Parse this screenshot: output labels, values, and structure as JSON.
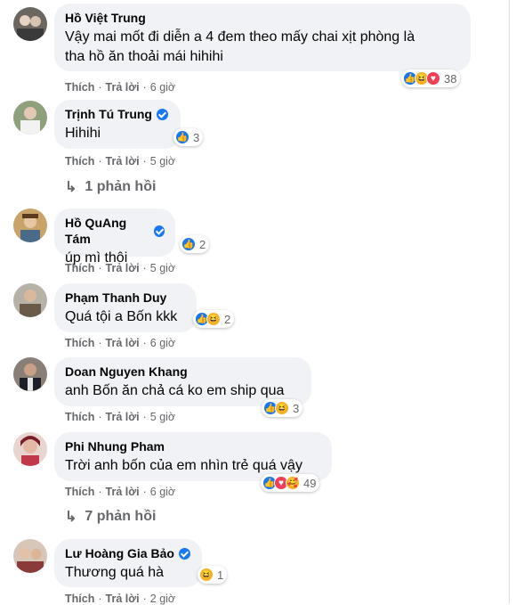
{
  "labels": {
    "like": "Thích",
    "reply": "Trả lời",
    "dot": "·"
  },
  "comments": [
    {
      "name": "Hồ Việt Trung",
      "verified": false,
      "text1": "Vậy mai mốt đi diễn a 4 đem theo mấy chai xịt phòng là",
      "text2": "tha hồ ăn thoải mái hihihi",
      "reactions": [
        "like",
        "haha",
        "love"
      ],
      "count": "38",
      "time": "6 giờ"
    },
    {
      "name": "Trịnh Tú Trung",
      "verified": true,
      "text1": "Hihihi",
      "reactions": [
        "like"
      ],
      "count": "3",
      "time": "5 giờ",
      "replies": "1 phản hồi"
    },
    {
      "name": "Hồ QuAng Tám",
      "verified": true,
      "text1": "úp mì thôi",
      "reactions": [
        "like"
      ],
      "count": "2",
      "time": "5 giờ"
    },
    {
      "name": "Phạm Thanh Duy",
      "verified": false,
      "text1": "Quá tội a Bốn kkk",
      "reactions": [
        "like",
        "haha"
      ],
      "count": "2",
      "time": "6 giờ"
    },
    {
      "name": "Doan Nguyen Khang",
      "verified": false,
      "text1": "anh Bốn ăn chả cá ko em ship qua",
      "reactions": [
        "like",
        "haha"
      ],
      "count": "3",
      "time": "5 giờ"
    },
    {
      "name": "Phi Nhung Pham",
      "verified": false,
      "text1": "Trời anh bốn của em nhìn trẻ quá vậy",
      "reactions": [
        "like",
        "love",
        "care"
      ],
      "count": "49",
      "time": "6 giờ",
      "replies": "7 phản hồi"
    },
    {
      "name": "Lư Hoàng Gia Bảo",
      "verified": true,
      "text1": "Thương quá hà",
      "reactions": [
        "haha"
      ],
      "count": "1",
      "time": "2 giờ"
    }
  ],
  "colors": {
    "bubble": "#f0f2f5",
    "meta": "#65676b",
    "like": "#1877f2",
    "love": "#f33e58",
    "haha": "#f7b125"
  },
  "icons": {
    "like": "thumbs-up-icon",
    "haha": "laughing-face-icon",
    "love": "heart-icon",
    "care": "care-face-icon",
    "reply": "reply-arrow-icon",
    "verified": "verified-badge-icon"
  }
}
